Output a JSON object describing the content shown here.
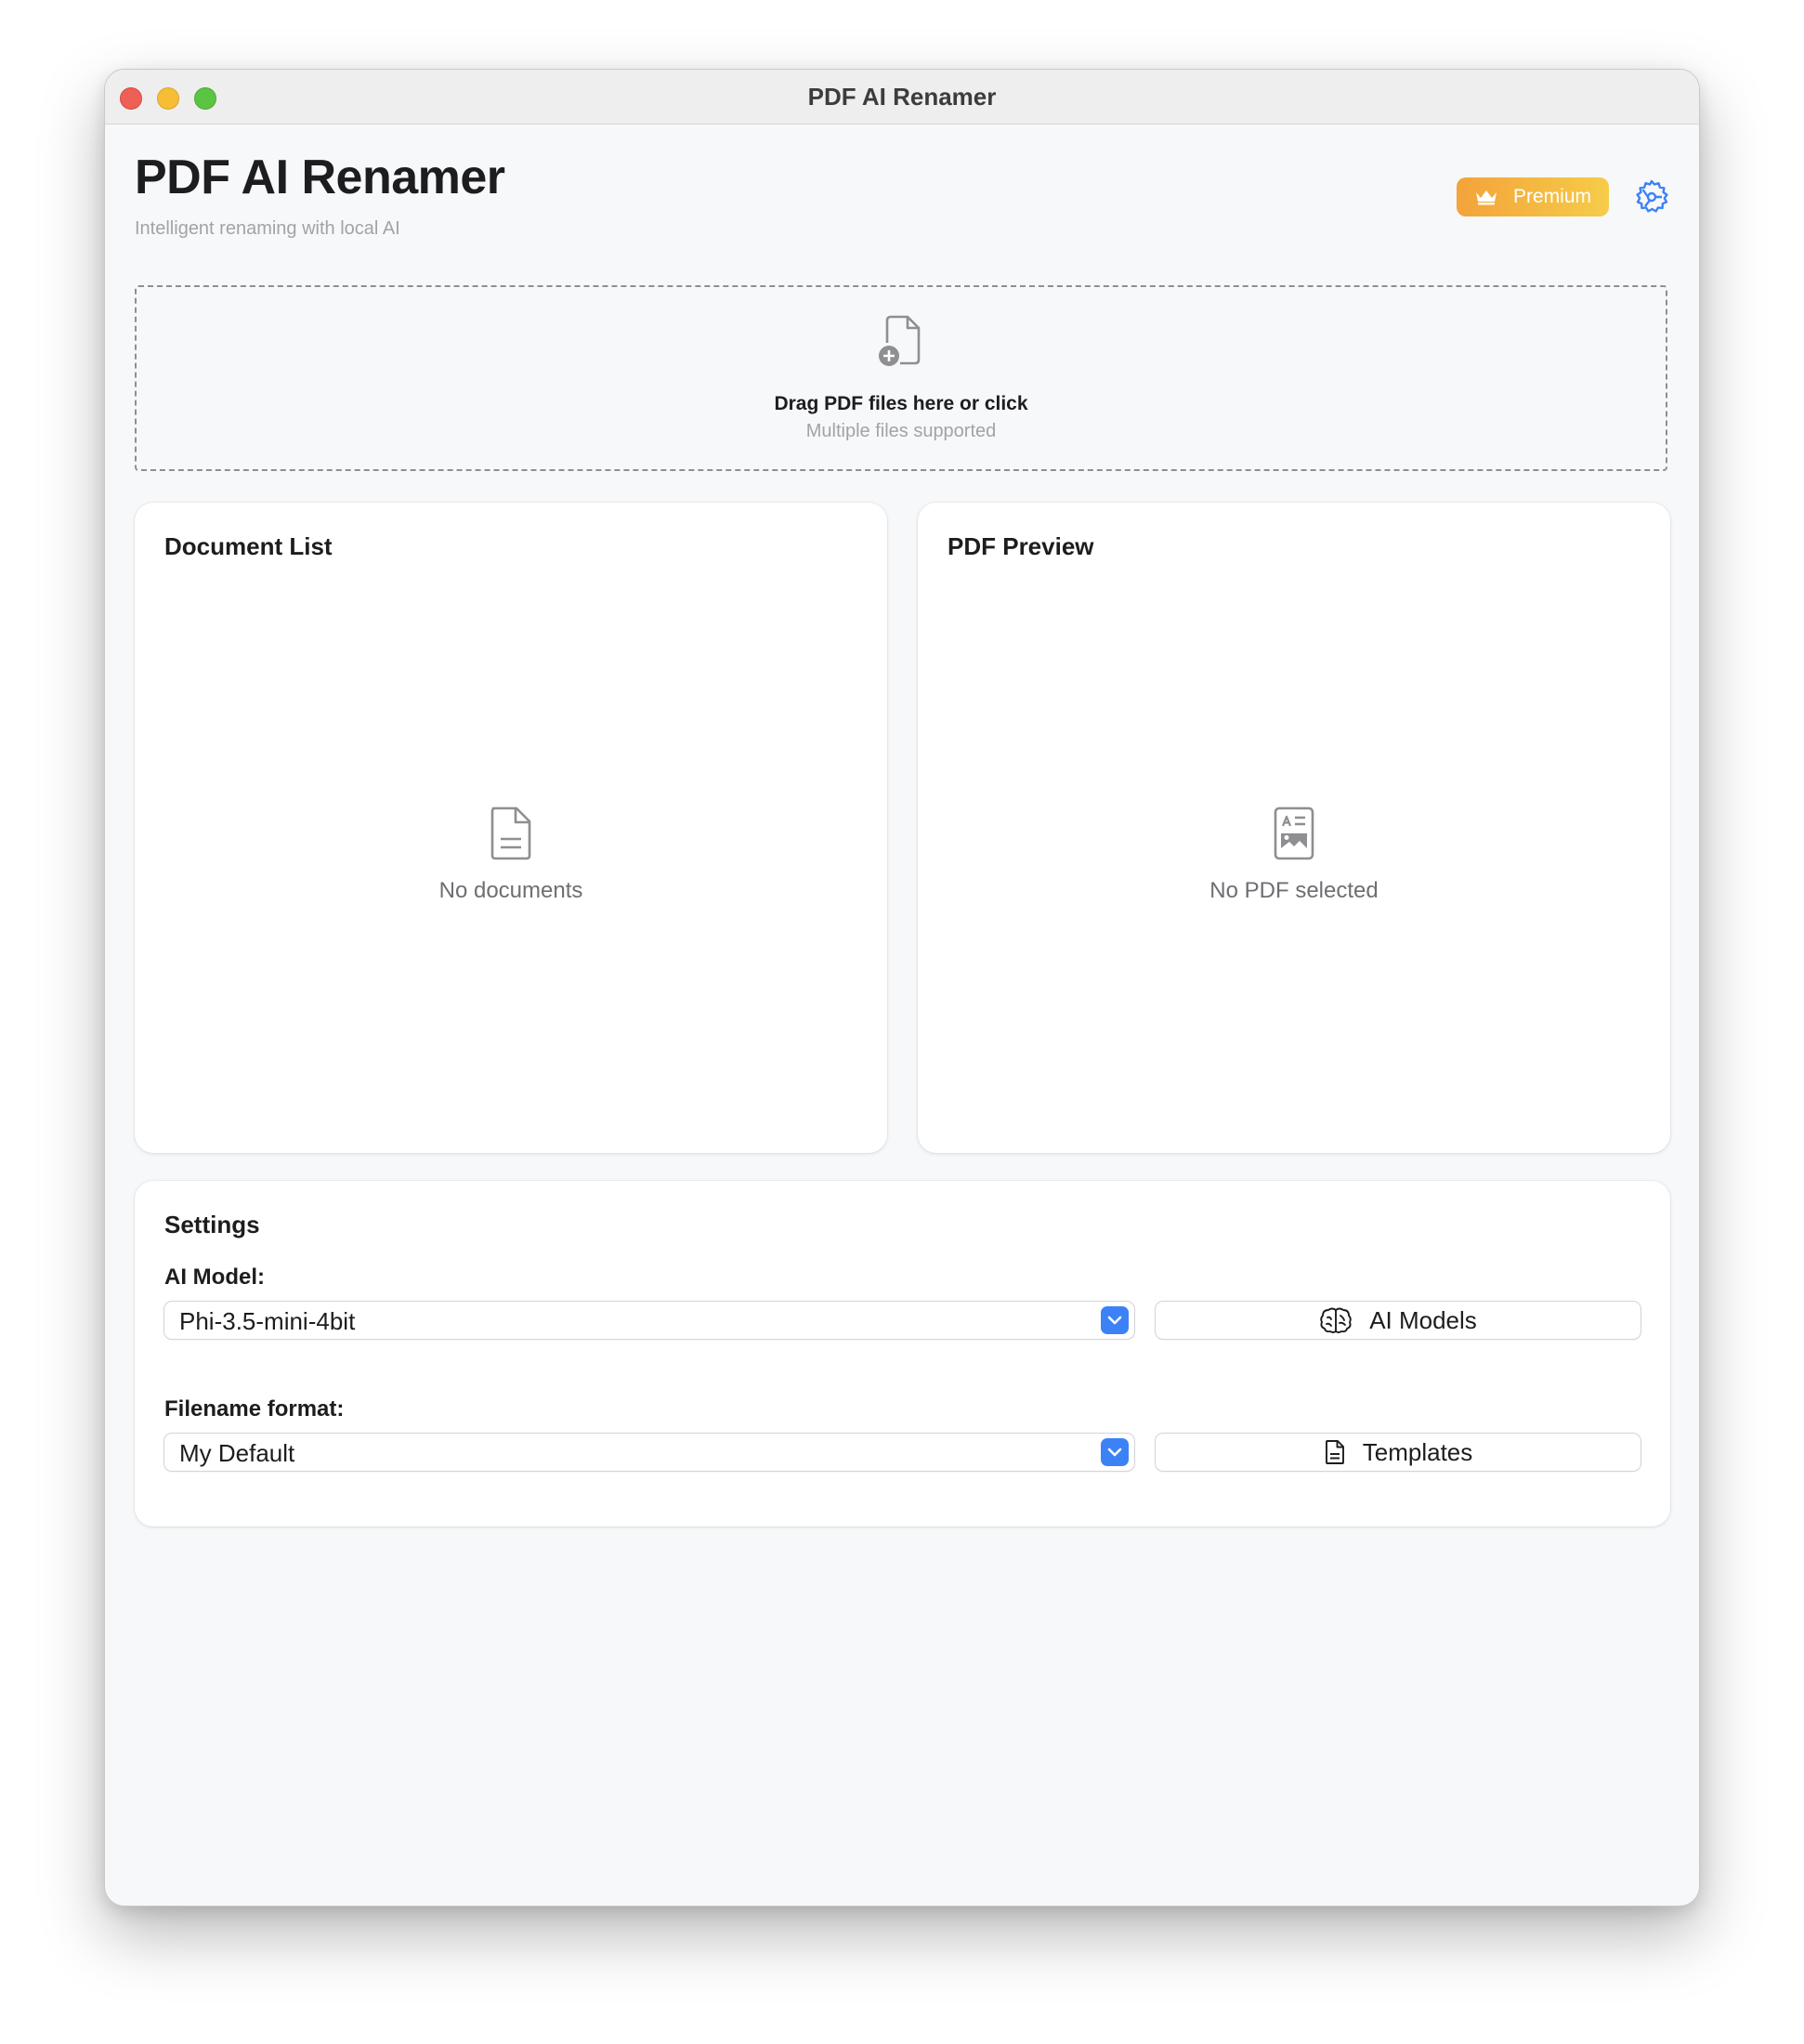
{
  "window": {
    "title": "PDF AI Renamer"
  },
  "header": {
    "title": "PDF AI Renamer",
    "subtitle": "Intelligent renaming with local AI",
    "premium_label": "Premium"
  },
  "dropzone": {
    "text": "Drag PDF files here or click",
    "subtext": "Multiple files supported",
    "icon": "document-add-icon"
  },
  "document_list": {
    "title": "Document List",
    "empty_text": "No documents",
    "icon": "document-icon"
  },
  "pdf_preview": {
    "title": "PDF Preview",
    "empty_text": "No PDF selected",
    "icon": "preview-icon"
  },
  "settings": {
    "title": "Settings",
    "ai_model": {
      "label": "AI Model:",
      "value": "Phi-3.5-mini-4bit",
      "button_label": "AI Models",
      "button_icon": "brain-icon"
    },
    "filename_format": {
      "label": "Filename format:",
      "value": "My Default",
      "button_label": "Templates",
      "button_icon": "document-icon"
    }
  },
  "colors": {
    "accent": "#3c82f6",
    "premium_start": "#f3a33a",
    "premium_end": "#f6cc49"
  }
}
